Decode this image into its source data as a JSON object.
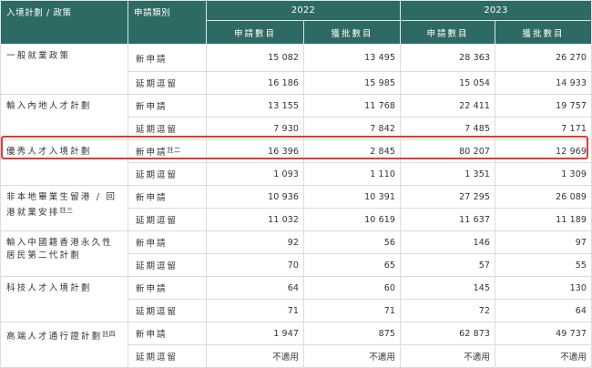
{
  "header": {
    "scheme": "入境計劃 / 政策",
    "category": "申請類別",
    "years": [
      "2022",
      "2023"
    ],
    "sub": [
      "申請數目",
      "獲批數目",
      "申請數目",
      "獲批數目"
    ]
  },
  "rows": [
    {
      "scheme": "一般就業政策",
      "note": "",
      "category": "新申請",
      "cat_note": "",
      "values": [
        "15 082",
        "13 495",
        "28 363",
        "26 270"
      ]
    },
    {
      "scheme": "",
      "note": "",
      "category": "延期逗留",
      "cat_note": "",
      "values": [
        "16 186",
        "15 985",
        "15 054",
        "14 933"
      ]
    },
    {
      "scheme": "輸入內地人才計劃",
      "note": "",
      "category": "新申請",
      "cat_note": "",
      "values": [
        "13 155",
        "11 768",
        "22 411",
        "19 757"
      ]
    },
    {
      "scheme": "",
      "note": "",
      "category": "延期逗留",
      "cat_note": "",
      "values": [
        "7 930",
        "7 842",
        "7 485",
        "7 171"
      ]
    },
    {
      "scheme": "優秀人才入境計劃",
      "note": "",
      "category": "新申請",
      "cat_note": "註二",
      "values": [
        "16 396",
        "2 845",
        "80 207",
        "12 969"
      ]
    },
    {
      "scheme": "",
      "note": "",
      "category": "延期逗留",
      "cat_note": "",
      "values": [
        "1 093",
        "1 110",
        "1 351",
        "1 309"
      ]
    },
    {
      "scheme": "非本地畢業生留港 / 回港就業安排",
      "note": "註三",
      "category": "新申請",
      "cat_note": "",
      "values": [
        "10 936",
        "10 391",
        "27 295",
        "26 089"
      ]
    },
    {
      "scheme": "",
      "note": "",
      "category": "延期逗留",
      "cat_note": "",
      "values": [
        "11 032",
        "10 619",
        "11 637",
        "11 189"
      ]
    },
    {
      "scheme": "輸入中國籍香港永久性居民第二代計劃",
      "note": "",
      "category": "新申請",
      "cat_note": "",
      "values": [
        "92",
        "56",
        "146",
        "97"
      ]
    },
    {
      "scheme": "",
      "note": "",
      "category": "延期逗留",
      "cat_note": "",
      "values": [
        "70",
        "65",
        "57",
        "55"
      ]
    },
    {
      "scheme": "科技人才入境計劃",
      "note": "",
      "category": "新申請",
      "cat_note": "",
      "values": [
        "64",
        "60",
        "145",
        "130"
      ]
    },
    {
      "scheme": "",
      "note": "",
      "category": "延期逗留",
      "cat_note": "",
      "values": [
        "71",
        "71",
        "72",
        "64"
      ]
    },
    {
      "scheme": "高端人才通行證計劃",
      "note": "註四",
      "category": "新申請",
      "cat_note": "",
      "values": [
        "1 947",
        "875",
        "62 873",
        "49 737"
      ]
    },
    {
      "scheme": "",
      "note": "",
      "category": "延期逗留",
      "cat_note": "",
      "values": [
        "不適用",
        "不適用",
        "不適用",
        "不適用"
      ]
    }
  ],
  "highlight_color": "#e53935",
  "header_color": "#2d6a63"
}
